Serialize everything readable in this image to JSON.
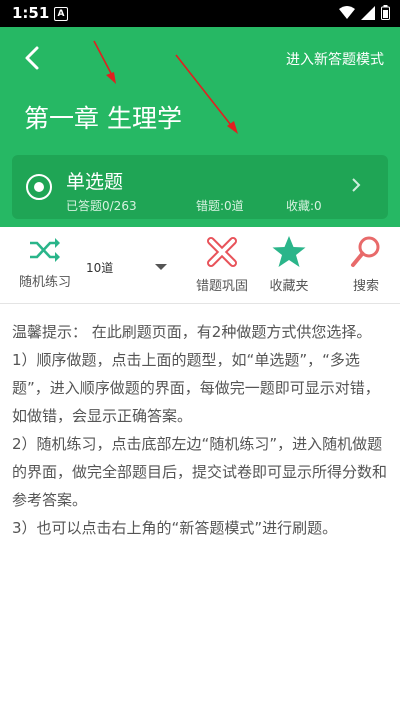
{
  "status_bar": {
    "time": "1:51",
    "notification_icon": "A"
  },
  "header": {
    "new_mode_label": "进入新答题模式",
    "chapter_title": "第一章 生理学",
    "card": {
      "question_type": "单选题",
      "answered": "已答题0/263",
      "wrong": "错题:0道",
      "favorites": "收藏:0"
    }
  },
  "toolbar": {
    "random_label": "随机练习",
    "count_value": "10道",
    "wrong_label": "错题巩固",
    "fav_label": "收藏夹",
    "search_label": "搜索"
  },
  "tips": {
    "intro": "温馨提示： 在此刷题页面，有2种做题方式供您选择。",
    "item1": "1）顺序做题，点击上面的题型，如“单选题”，“多选题”，进入顺序做题的界面，每做完一题即可显示对错，如做错，会显示正确答案。",
    "item2": "2）随机练习，点击底部左边“随机练习”，进入随机做题的界面，做完全部题目后，提交试卷即可显示所得分数和参考答案。",
    "item3": "3）也可以点击右上角的“新答题模式”进行刷题。"
  },
  "colors": {
    "primary": "#26b864",
    "card": "#1fa555",
    "wrong": "#e8535a",
    "fav": "#2bb58a",
    "search": "#e86a6a"
  }
}
